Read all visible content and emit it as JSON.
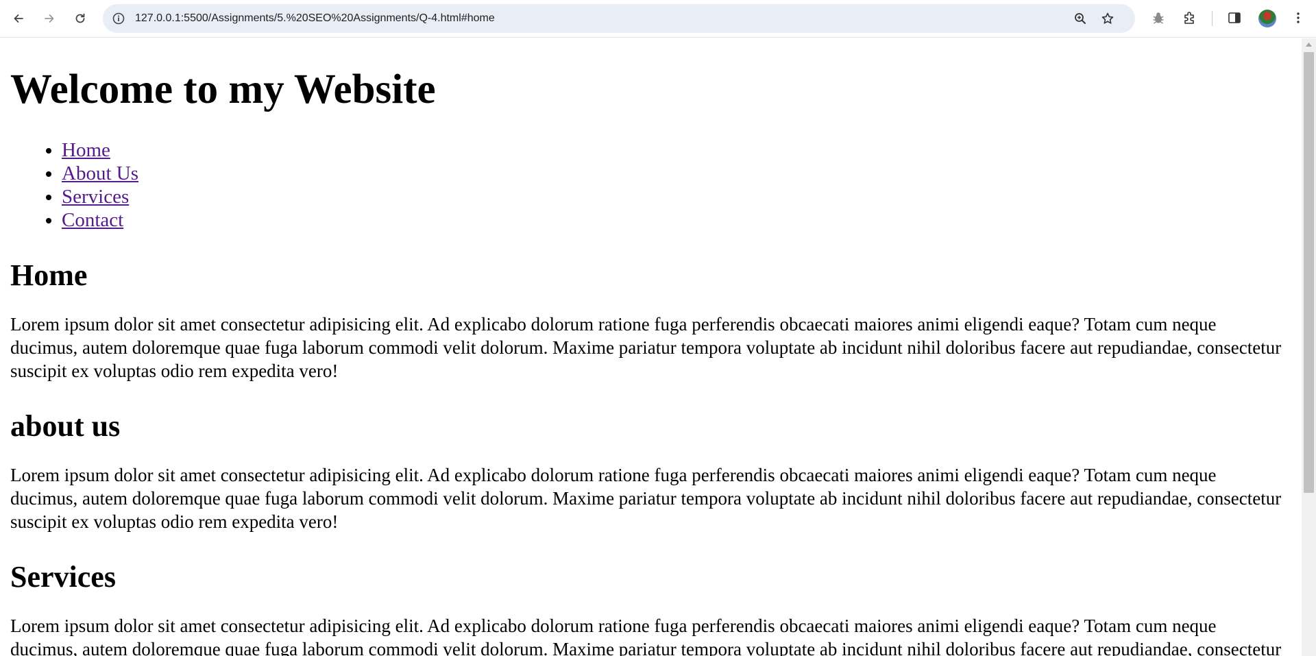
{
  "browser": {
    "url": "127.0.0.1:5500/Assignments/5.%20SEO%20Assignments/Q-4.html#home",
    "icons": {
      "back": "arrow-left-icon",
      "forward": "arrow-right-icon",
      "reload": "reload-icon",
      "site_info": "info-icon",
      "zoom": "zoom-icon",
      "bookmark": "star-icon",
      "extension_bug": "bug-icon",
      "extensions": "puzzle-icon",
      "side_panel": "side-panel-icon",
      "menu": "kebab-menu-icon"
    }
  },
  "page": {
    "title": "Welcome to my Website",
    "nav": [
      {
        "label": "Home"
      },
      {
        "label": "About Us"
      },
      {
        "label": "Services"
      },
      {
        "label": "Contact"
      }
    ],
    "sections": [
      {
        "heading": "Home",
        "body": "Lorem ipsum dolor sit amet consectetur adipisicing elit. Ad explicabo dolorum ratione fuga perferendis obcaecati maiores animi eligendi eaque? Totam cum neque ducimus, autem doloremque quae fuga laborum commodi velit dolorum. Maxime pariatur tempora voluptate ab incidunt nihil doloribus facere aut repudiandae, consectetur suscipit ex voluptas odio rem expedita vero!"
      },
      {
        "heading": "about us",
        "body": "Lorem ipsum dolor sit amet consectetur adipisicing elit. Ad explicabo dolorum ratione fuga perferendis obcaecati maiores animi eligendi eaque? Totam cum neque ducimus, autem doloremque quae fuga laborum commodi velit dolorum. Maxime pariatur tempora voluptate ab incidunt nihil doloribus facere aut repudiandae, consectetur suscipit ex voluptas odio rem expedita vero!"
      },
      {
        "heading": "Services",
        "body": "Lorem ipsum dolor sit amet consectetur adipisicing elit. Ad explicabo dolorum ratione fuga perferendis obcaecati maiores animi eligendi eaque? Totam cum neque ducimus, autem doloremque quae fuga laborum commodi velit dolorum. Maxime pariatur tempora voluptate ab incidunt nihil doloribus facere aut repudiandae, consectetur suscipit ex voluptas odio rem expedita vero!"
      }
    ]
  },
  "colors": {
    "link_visited": "#551a8b",
    "omnibox_bg": "#e9edf6",
    "scroll_thumb": "#c1c1c1"
  }
}
